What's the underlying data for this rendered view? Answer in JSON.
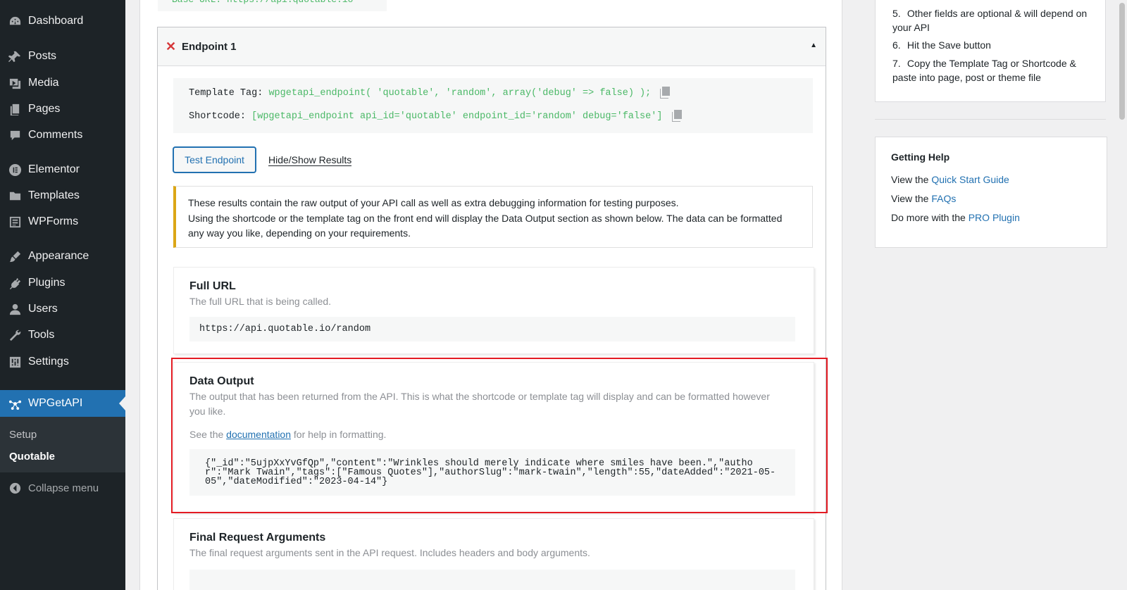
{
  "sidebar": {
    "items": [
      {
        "label": "Dashboard",
        "icon": "dashboard-icon"
      },
      {
        "label": "Posts",
        "icon": "pin-icon"
      },
      {
        "label": "Media",
        "icon": "media-icon"
      },
      {
        "label": "Pages",
        "icon": "pages-icon"
      },
      {
        "label": "Comments",
        "icon": "comment-icon"
      },
      {
        "label": "Elementor",
        "icon": "elementor-icon"
      },
      {
        "label": "Templates",
        "icon": "folder-icon"
      },
      {
        "label": "WPForms",
        "icon": "form-icon"
      },
      {
        "label": "Appearance",
        "icon": "brush-icon"
      },
      {
        "label": "Plugins",
        "icon": "plug-icon"
      },
      {
        "label": "Users",
        "icon": "user-icon"
      },
      {
        "label": "Tools",
        "icon": "wrench-icon"
      },
      {
        "label": "Settings",
        "icon": "sliders-icon"
      },
      {
        "label": "WPGetAPI",
        "icon": "network-icon"
      }
    ],
    "submenu": [
      "Setup",
      "Quotable"
    ],
    "collapse_label": "Collapse menu"
  },
  "main": {
    "base_url_fragment": "Base URL: https://api.quotable.io",
    "endpoint": {
      "title": "Endpoint 1",
      "template_tag_label": "Template Tag:",
      "template_tag_value": "wpgetapi_endpoint( 'quotable', 'random', array('debug' => false) );",
      "shortcode_label": "Shortcode:",
      "shortcode_value": "[wpgetapi_endpoint api_id='quotable' endpoint_id='random' debug='false']",
      "test_button": "Test Endpoint",
      "hide_show": "Hide/Show Results",
      "notice_line1": "These results contain the raw output of your API call as well as extra debugging information for testing purposes.",
      "notice_line2": "Using the shortcode or the template tag on the front end will display the Data Output section as shown below. The data can be formatted any way you like, depending on your requirements.",
      "full_url_title": "Full URL",
      "full_url_desc": "The full URL that is being called.",
      "full_url_value": "https://api.quotable.io/random",
      "data_output_title": "Data Output",
      "data_output_desc": "The output that has been returned from the API. This is what the shortcode or template tag will display and can be formatted however you like.",
      "help_prefix": "See the",
      "help_link": "documentation",
      "help_suffix": "for help in formatting.",
      "json_output": "{\"_id\":\"5ujpXxYvGfQp\",\"content\":\"Wrinkles should merely indicate where smiles have been.\",\"author\":\"Mark Twain\",\"tags\":[\"Famous Quotes\"],\"authorSlug\":\"mark-twain\",\"length\":55,\"dateAdded\":\"2021-05-05\",\"dateModified\":\"2023-04-14\"}",
      "final_args_title": "Final Request Arguments",
      "final_args_desc": "The final request arguments sent in the API request. Includes headers and body arguments."
    }
  },
  "right": {
    "steps": [
      {
        "num": "5.",
        "text": "Other fields are optional & will depend on your API"
      },
      {
        "num": "6.",
        "text": "Hit the Save button"
      },
      {
        "num": "7.",
        "text": "Copy the Template Tag or Shortcode & paste into page, post or theme file"
      }
    ],
    "help": {
      "title": "Getting Help",
      "line1_prefix": "View the",
      "line1_link": "Quick Start Guide",
      "line2_prefix": "View the",
      "line2_link": "FAQs",
      "line3_prefix": "Do more with the",
      "line3_link": "PRO Plugin"
    }
  },
  "colors": {
    "sidebar_bg": "#1d2327",
    "accent": "#2271b1",
    "code_green": "#4ab866",
    "highlight_red": "#e31b23",
    "notice_yellow": "#dba617"
  }
}
